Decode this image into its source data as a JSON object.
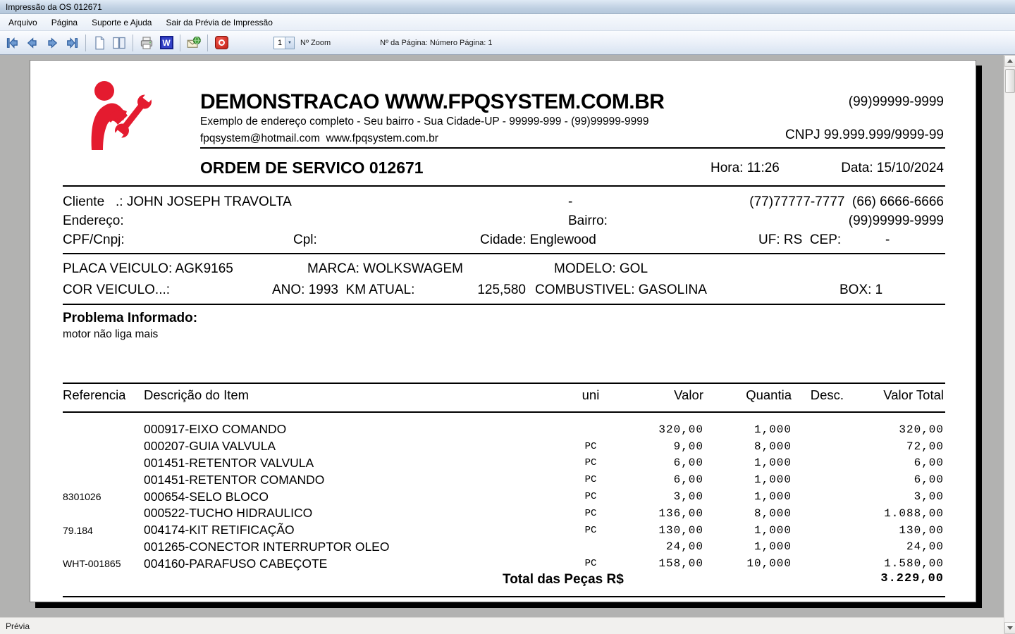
{
  "window": {
    "title": "Impressão da OS 012671"
  },
  "menu": {
    "items": [
      "Arquivo",
      "Página",
      "Suporte e Ajuda",
      "Sair da Prévia de Impressão"
    ]
  },
  "toolbar": {
    "zoom_value": "1",
    "zoom_label": "Nº Zoom",
    "page_info": "Nº da Página: Número Página: 1"
  },
  "status": {
    "text": "Prévia"
  },
  "colors": {
    "brand_red": "#e41b2f",
    "nav_arrow_blue": "#6f9bd2"
  },
  "document": {
    "header": {
      "company_name": "DEMONSTRACAO WWW.FPQSYSTEM.COM.BR",
      "address_line": "Exemplo de endereço completo - Seu bairro - Sua Cidade-UP - 99999-999 - (99)99999-9999",
      "contact_line": "fpqsystem@hotmail.com  www.fpqsystem.com.br",
      "phone": "(99)99999-9999",
      "cnpj": "CNPJ 99.999.999/9999-99"
    },
    "order": {
      "title": "ORDEM DE SERVICO 012671",
      "time": "Hora: 11:26",
      "date": "Data: 15/10/2024"
    },
    "client": {
      "line1_left": "Cliente   .: JOHN JOSEPH TRAVOLTA",
      "line1_mid": "-",
      "line1_right": "(77)77777-7777  (66) 6666-6666",
      "line2_left": "Endereço:",
      "line2_mid": "Bairro:",
      "line2_right": "(99)99999-9999",
      "line3_left": "CPF/Cnpj:",
      "line3_cpl": "Cpl:",
      "line3_cidade": "Cidade: Englewood",
      "line3_uf": "UF: RS  CEP:",
      "line3_cep": "-"
    },
    "vehicle": {
      "placa": "PLACA VEICULO: AGK9165",
      "marca": "MARCA: WOLKSWAGEM",
      "modelo": "MODELO: GOL",
      "cor": "COR VEICULO...:",
      "ano_km": "ANO: 1993  KM ATUAL:",
      "km_value": "125,580",
      "combustivel": "COMBUSTIVEL: GASOLINA",
      "box": "BOX: 1"
    },
    "problem": {
      "label": "Problema Informado:",
      "text": "motor não liga mais"
    },
    "table": {
      "headers": {
        "ref": "Referencia",
        "desc": "Descrição do Item",
        "uni": "uni",
        "valor": "Valor",
        "quantia": "Quantia",
        "desconto": "Desc.",
        "total": "Valor Total"
      },
      "rows": [
        {
          "ref": "",
          "desc": "000917-EIXO COMANDO",
          "uni": "",
          "valor": "320,00",
          "quantia": "1,000",
          "desconto": "",
          "total": "320,00"
        },
        {
          "ref": "",
          "desc": "000207-GUIA VALVULA",
          "uni": "PC",
          "valor": "9,00",
          "quantia": "8,000",
          "desconto": "",
          "total": "72,00"
        },
        {
          "ref": "",
          "desc": "001451-RETENTOR VALVULA",
          "uni": "PC",
          "valor": "6,00",
          "quantia": "1,000",
          "desconto": "",
          "total": "6,00"
        },
        {
          "ref": "",
          "desc": "001451-RETENTOR COMANDO",
          "uni": "PC",
          "valor": "6,00",
          "quantia": "1,000",
          "desconto": "",
          "total": "6,00"
        },
        {
          "ref": "8301026",
          "desc": "000654-SELO BLOCO",
          "uni": "PC",
          "valor": "3,00",
          "quantia": "1,000",
          "desconto": "",
          "total": "3,00"
        },
        {
          "ref": "",
          "desc": "000522-TUCHO HIDRAULICO",
          "uni": "PC",
          "valor": "136,00",
          "quantia": "8,000",
          "desconto": "",
          "total": "1.088,00"
        },
        {
          "ref": "79.184",
          "desc": "004174-KIT RETIFICAÇÃO",
          "uni": "PC",
          "valor": "130,00",
          "quantia": "1,000",
          "desconto": "",
          "total": "130,00"
        },
        {
          "ref": "",
          "desc": "001265-CONECTOR INTERRUPTOR OLEO",
          "uni": "",
          "valor": "24,00",
          "quantia": "1,000",
          "desconto": "",
          "total": "24,00"
        },
        {
          "ref": "WHT-001865",
          "desc": "004160-PARAFUSO CABEÇOTE",
          "uni": "PC",
          "valor": "158,00",
          "quantia": "10,000",
          "desconto": "",
          "total": "1.580,00"
        }
      ],
      "total_label": "Total das Peças R$",
      "total_value": "3.229,00"
    }
  }
}
